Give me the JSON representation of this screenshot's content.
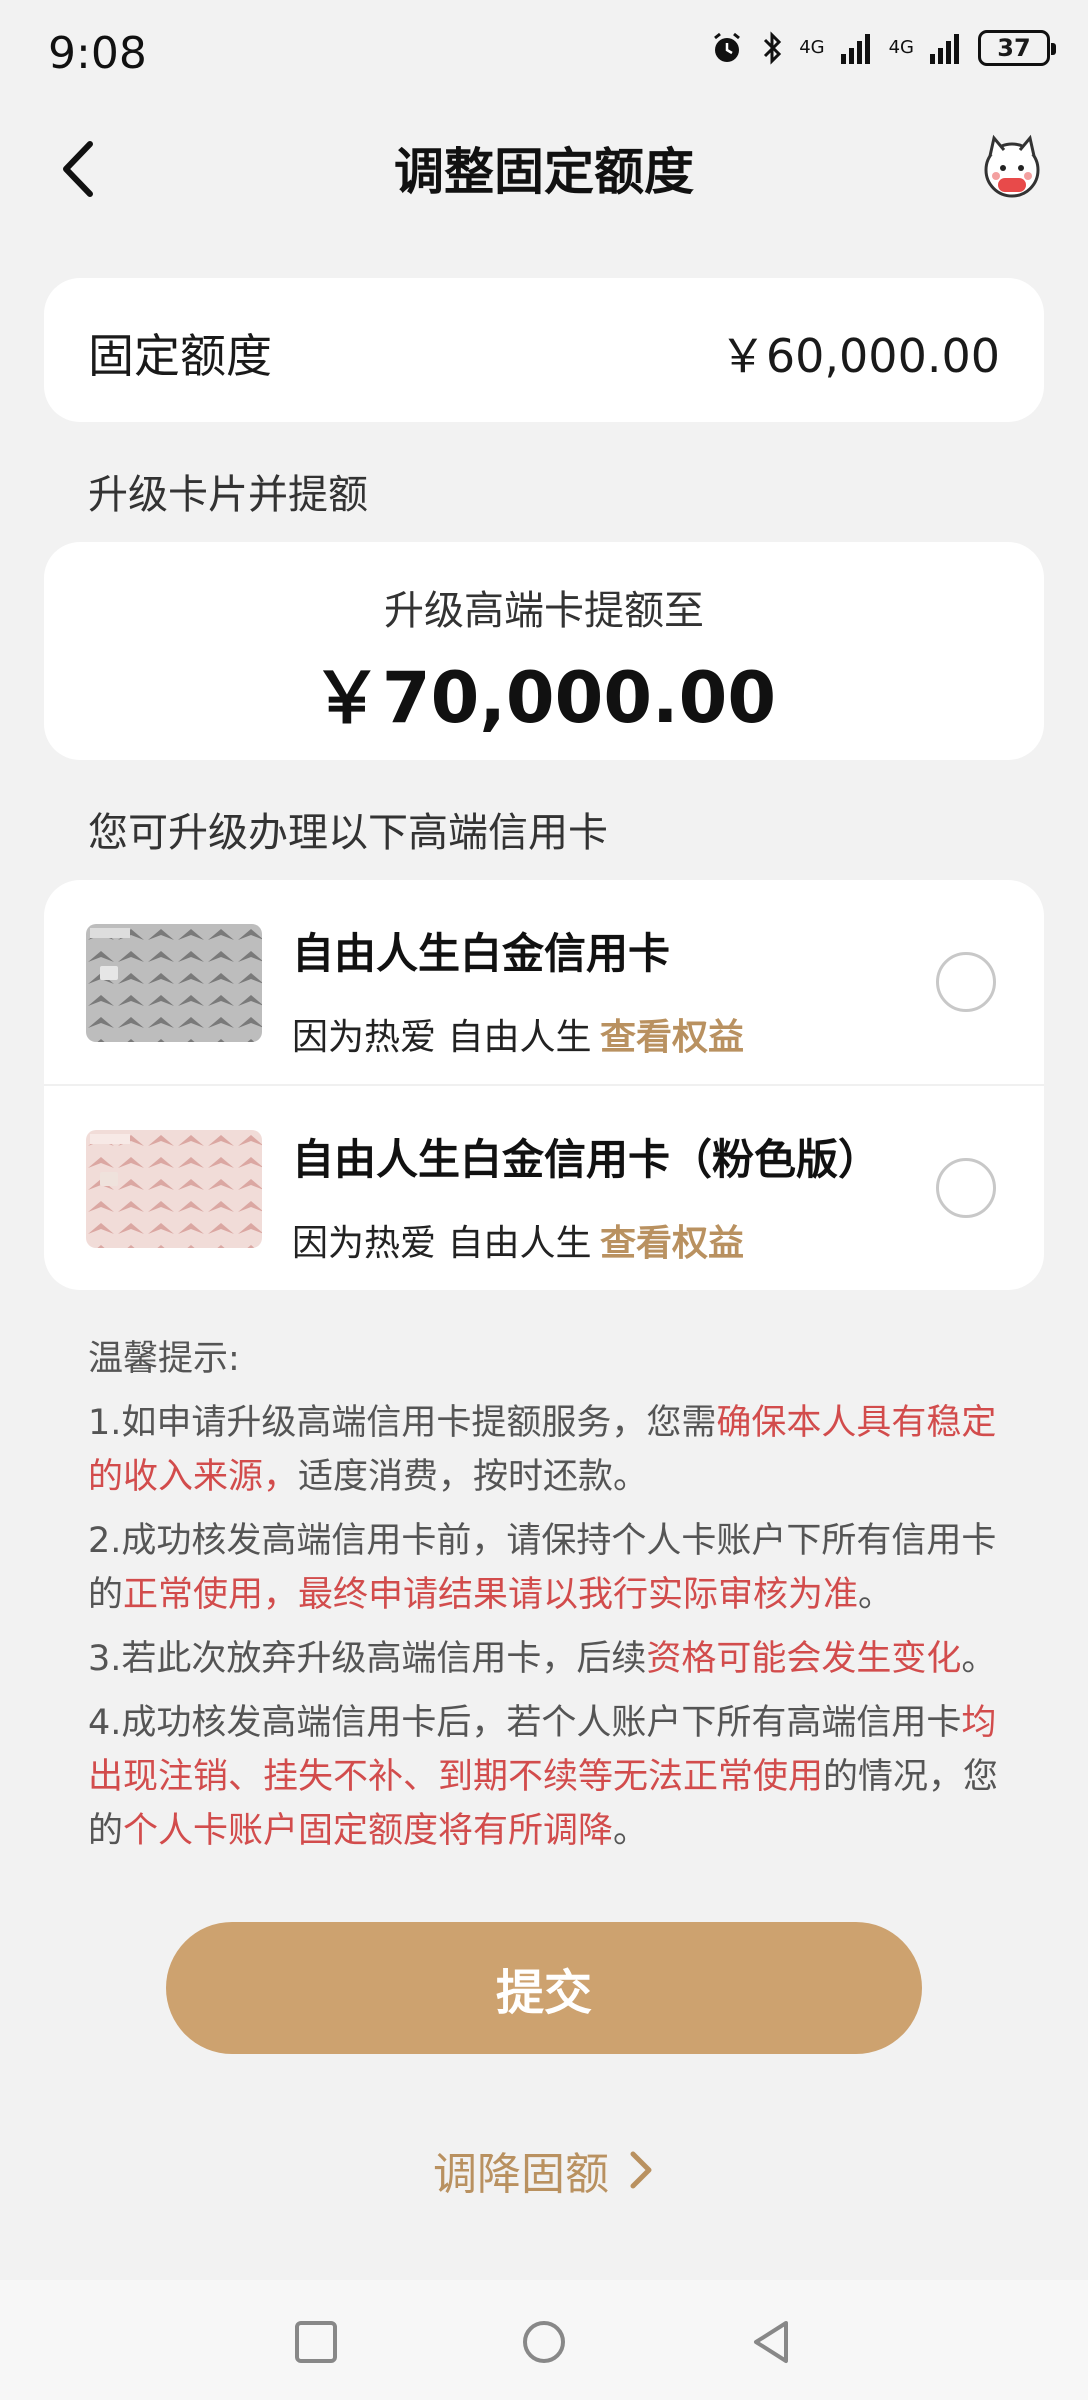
{
  "status_bar": {
    "time": "9:08",
    "network_1": "4G",
    "network_2": "4G",
    "battery": "37",
    "icons": [
      "alarm-icon",
      "bluetooth-icon",
      "signal-icon",
      "signal-icon",
      "battery-icon"
    ]
  },
  "header": {
    "title": "调整固定额度",
    "back_icon": "chevron-left-icon",
    "assistant_icon": "mascot-icon"
  },
  "fixed_limit": {
    "label": "固定额度",
    "value": "￥60,000.00"
  },
  "upgrade_section": {
    "title": "升级卡片并提额",
    "caption": "升级高端卡提额至",
    "amount": "￥70,000.00"
  },
  "card_section": {
    "title": "您可升级办理以下高端信用卡",
    "cards": [
      {
        "name": "自由人生白金信用卡",
        "slogan": "因为热爱 自由人生",
        "benefit_link": "查看权益",
        "selected": false
      },
      {
        "name": "自由人生白金信用卡（粉色版）",
        "slogan": "因为热爱 自由人生",
        "benefit_link": "查看权益",
        "selected": false
      }
    ]
  },
  "tips": {
    "title": "温馨提示:",
    "tip1": {
      "a": "1.如申请升级高端信用卡提额服务，您需",
      "b": "确保本人具有稳定的收入来源，",
      "c": "适度消费，按时还款。"
    },
    "tip2": {
      "a": "2.成功核发高端信用卡前，请保持个人卡账户下所有信用卡的",
      "b": "正常使用，最终申请结果请以我行实际审核为准",
      "c": "。"
    },
    "tip3": {
      "a": "3.若此次放弃升级高端信用卡，后续",
      "b": "资格可能会发生变化",
      "c": "。"
    },
    "tip4": {
      "a": "4.成功核发高端信用卡后，若个人账户下所有高端信用卡",
      "b": "均出现注销、挂失不补、到期不续等无法正常使用",
      "c": "的情况，您的",
      "d": "个人卡账户固定额度将有所调降",
      "e": "。"
    }
  },
  "actions": {
    "submit_label": "提交",
    "reduce_label": "调降固额"
  },
  "colors": {
    "accent": "#cda26f",
    "link": "#b99160",
    "warning": "#d24c4c",
    "background": "#f2f2f2"
  }
}
